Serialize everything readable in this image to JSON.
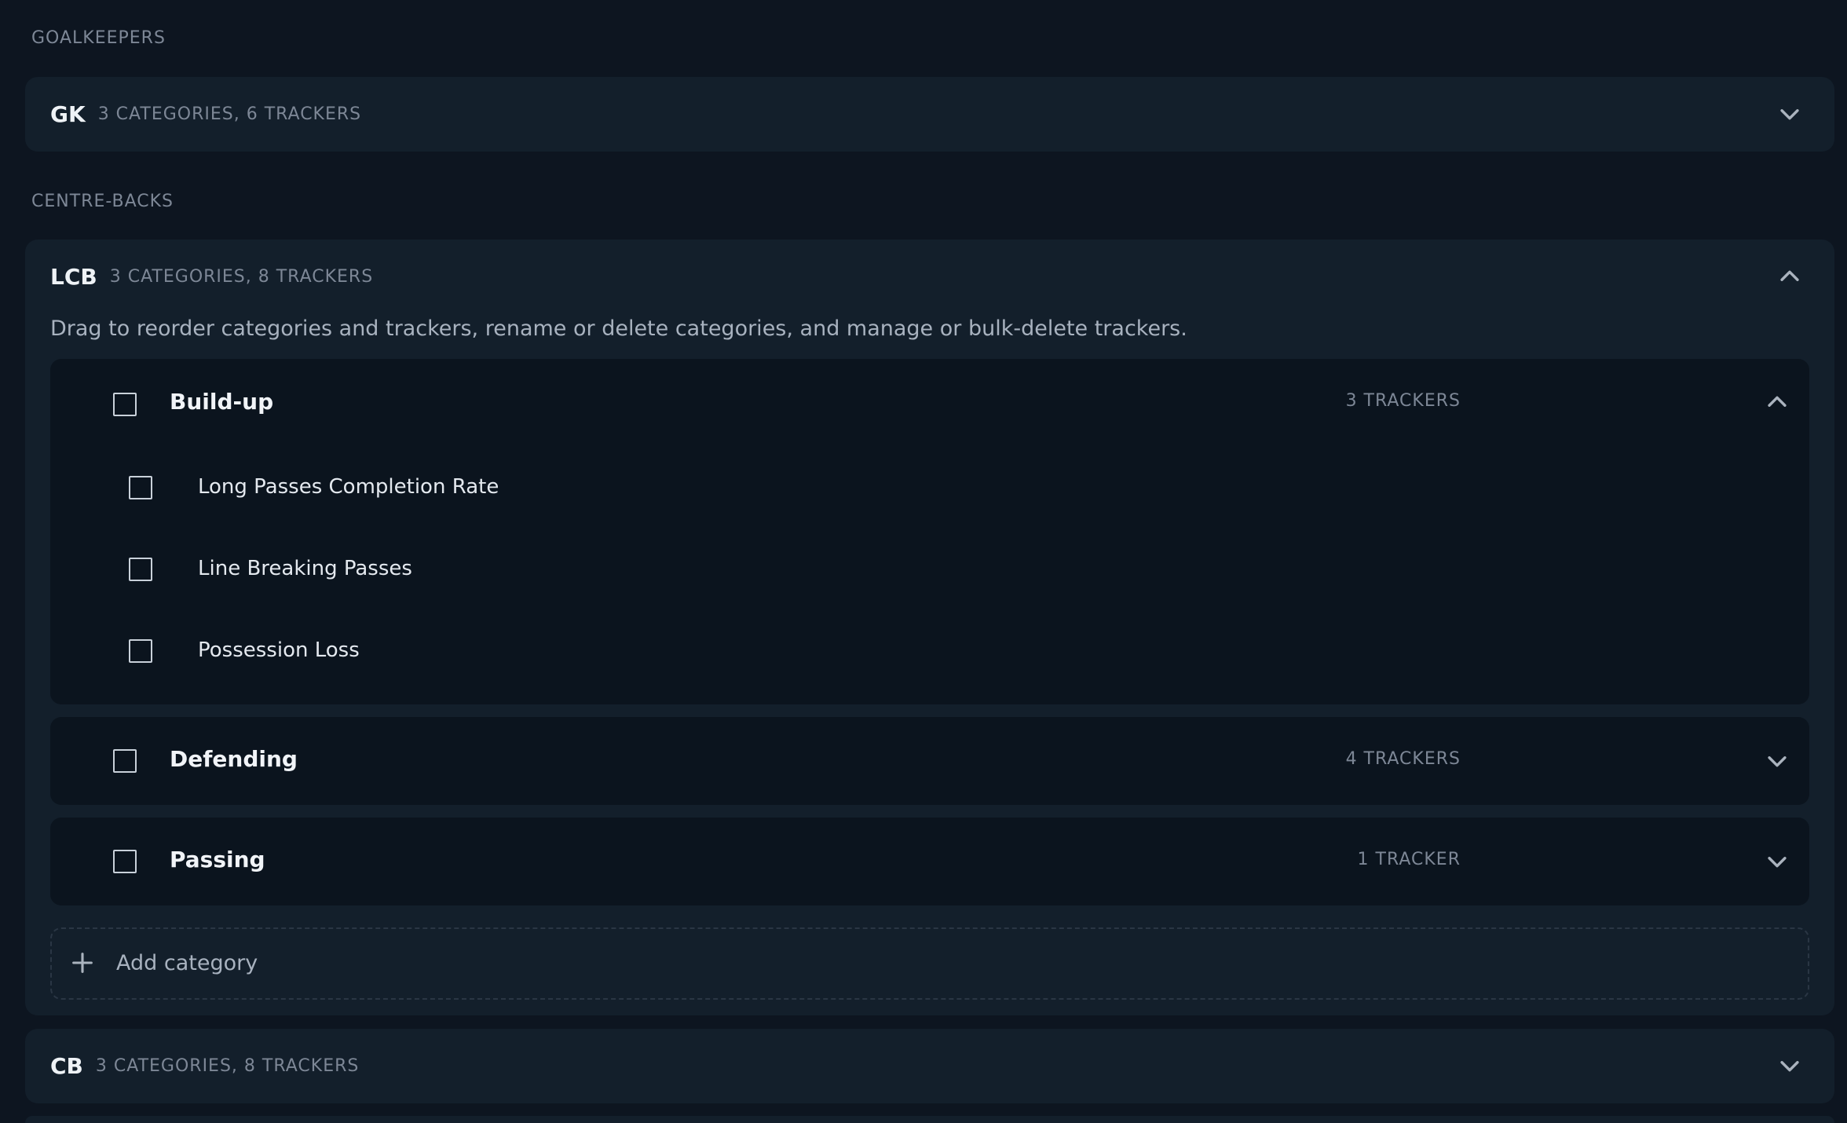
{
  "groups": {
    "goalkeepers": {
      "label": "GOALKEEPERS",
      "cards": [
        {
          "code": "GK",
          "meta": "3 CATEGORIES, 6 TRACKERS",
          "expanded": false
        }
      ]
    },
    "centre_backs": {
      "label": "CENTRE-BACKS",
      "lcb": {
        "code": "LCB",
        "meta": "3 CATEGORIES, 8 TRACKERS",
        "expanded": true,
        "description": "Drag to reorder categories and trackers, rename or delete categories, and manage or bulk-delete trackers.",
        "categories": [
          {
            "name": "Build-up",
            "count": "3 TRACKERS",
            "expanded": true,
            "trackers": [
              "Long Passes Completion Rate",
              "Line Breaking Passes",
              "Possession Loss"
            ]
          },
          {
            "name": "Defending",
            "count": "4 TRACKERS",
            "expanded": false
          },
          {
            "name": "Passing",
            "count": "1 TRACKER",
            "expanded": false
          }
        ],
        "add_category_label": "Add category"
      },
      "cb": {
        "code": "CB",
        "meta": "3 CATEGORIES, 8 TRACKERS",
        "expanded": false
      }
    }
  },
  "icons": {
    "chevron_down": "chevron-down-icon",
    "chevron_up": "chevron-up-icon",
    "plus": "plus-icon",
    "checkbox": "checkbox-icon"
  },
  "colors": {
    "background": "#0d1520",
    "card": "#131f2b",
    "category": "#0b141e",
    "muted_text": "#7d8796"
  }
}
